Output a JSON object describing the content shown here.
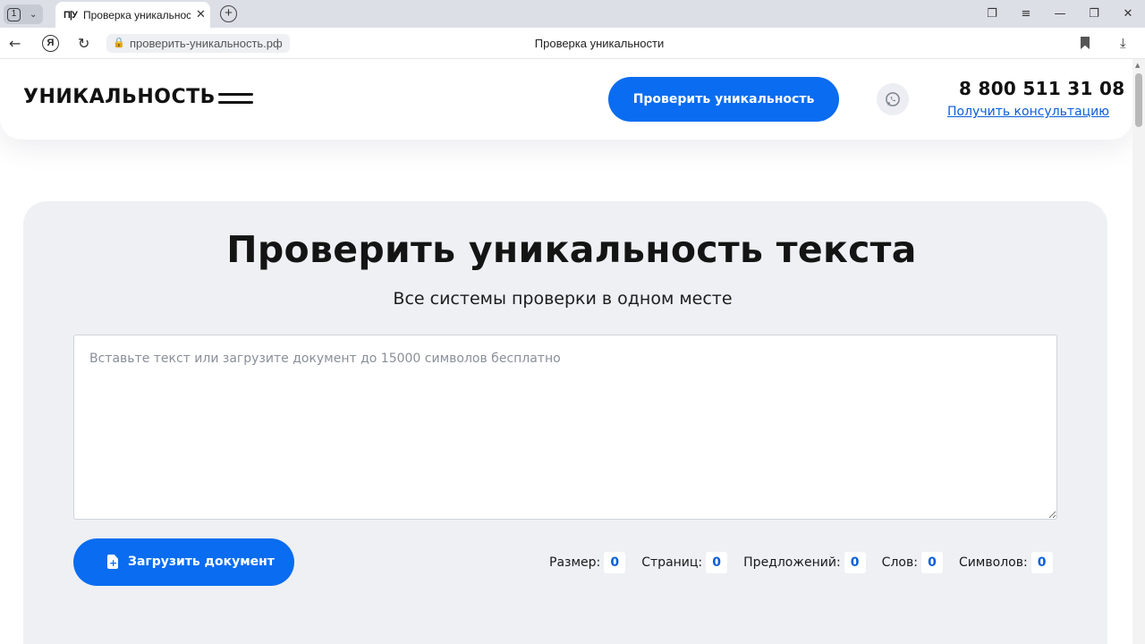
{
  "browser": {
    "tab_count": "1",
    "tab_title": "Проверка уникальност",
    "tab_favicon": "П|У",
    "address": "проверить-уникальность.рф",
    "page_title": "Проверка уникальности"
  },
  "header": {
    "logo": "УНИКАЛЬНОСТЬ",
    "check_button": "Проверить уникальность",
    "phone": "8 800 511 31 08",
    "consult_link": "Получить консультацию",
    "whatsapp_icon": "whatsapp-icon"
  },
  "hero": {
    "title": "Проверить уникальность текста",
    "subtitle": "Все системы проверки в одном месте",
    "textarea_placeholder": "Вставьте текст или загрузите документ до 15000 символов бесплатно",
    "upload_button": "Загрузить документ"
  },
  "stats": [
    {
      "label": "Размер:",
      "value": "0"
    },
    {
      "label": "Страниц:",
      "value": "0"
    },
    {
      "label": "Предложений:",
      "value": "0"
    },
    {
      "label": "Слов:",
      "value": "0"
    },
    {
      "label": "Символов:",
      "value": "0"
    }
  ],
  "colors": {
    "accent": "#0a6cf0",
    "hero_bg": "#eef0f4"
  }
}
